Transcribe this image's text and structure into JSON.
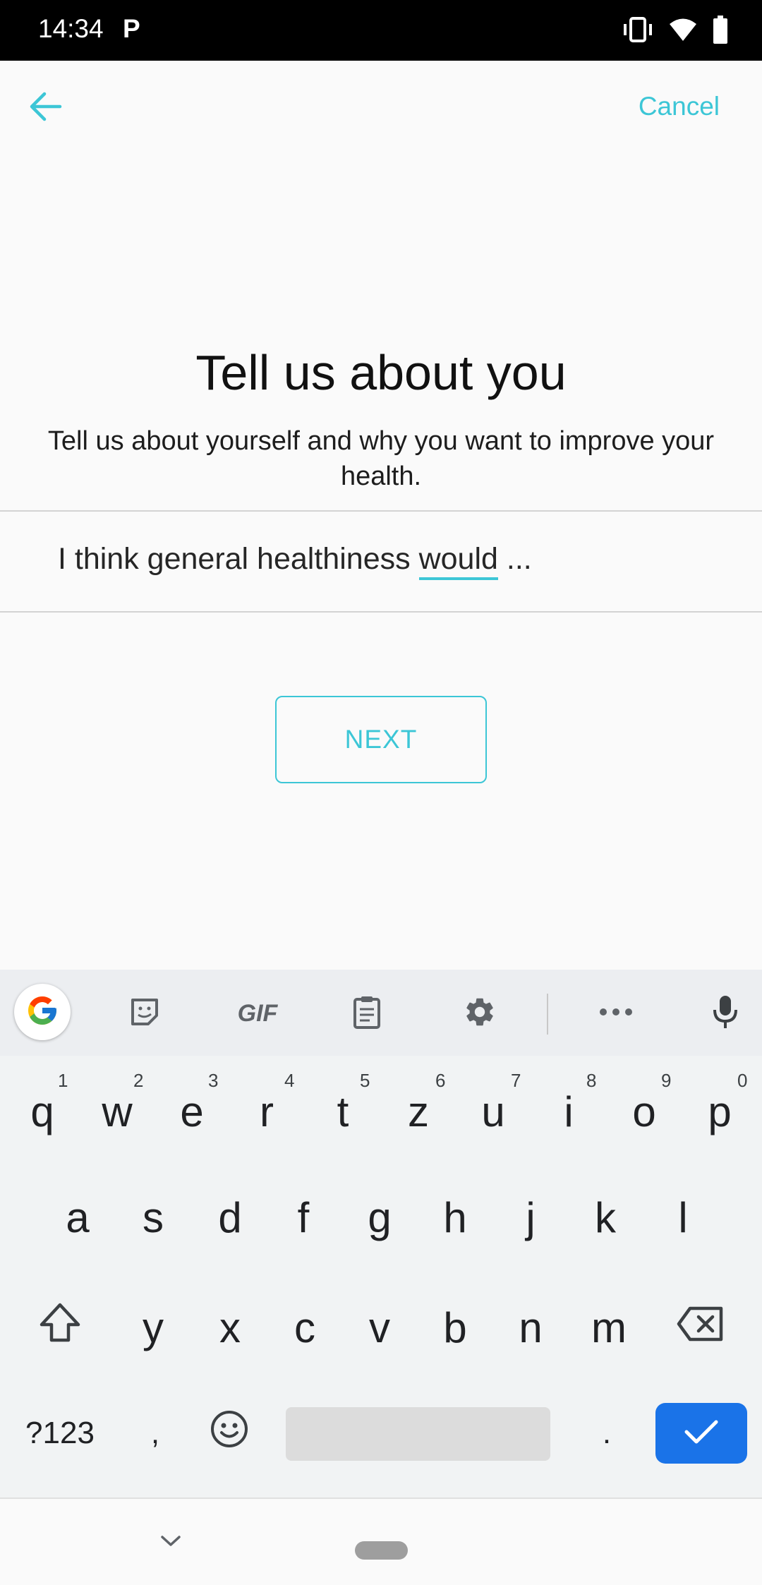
{
  "status_bar": {
    "time": "14:34",
    "app_indicator": "P",
    "icons": [
      "vibrate-icon",
      "wifi-icon",
      "battery-icon"
    ]
  },
  "app_bar": {
    "back_icon": "arrow-back-icon",
    "cancel_label": "Cancel"
  },
  "content": {
    "title": "Tell us about you",
    "subtitle": "Tell us about yourself and why you want to improve your health.",
    "answer_prefix": "I think general healthiness ",
    "answer_underlined": "would",
    "answer_suffix": " ...",
    "next_label": "NEXT"
  },
  "keyboard": {
    "toolbar": [
      "google-icon",
      "sticker-icon",
      "gif",
      "clipboard-icon",
      "gear-icon",
      "more-icon",
      "mic-icon"
    ],
    "gif_label": "GIF",
    "row1": [
      {
        "key": "q",
        "hint": "1"
      },
      {
        "key": "w",
        "hint": "2"
      },
      {
        "key": "e",
        "hint": "3"
      },
      {
        "key": "r",
        "hint": "4"
      },
      {
        "key": "t",
        "hint": "5"
      },
      {
        "key": "z",
        "hint": "6"
      },
      {
        "key": "u",
        "hint": "7"
      },
      {
        "key": "i",
        "hint": "8"
      },
      {
        "key": "o",
        "hint": "9"
      },
      {
        "key": "p",
        "hint": "0"
      }
    ],
    "row2": [
      "a",
      "s",
      "d",
      "f",
      "g",
      "h",
      "j",
      "k",
      "l"
    ],
    "row3": [
      "y",
      "x",
      "c",
      "v",
      "b",
      "n",
      "m"
    ],
    "symbols_label": "?123",
    "comma_label": ",",
    "period_label": ".",
    "accent_color": "#1a73e8"
  },
  "colors": {
    "accent": "#3cc6d6",
    "background": "#fafafa"
  }
}
